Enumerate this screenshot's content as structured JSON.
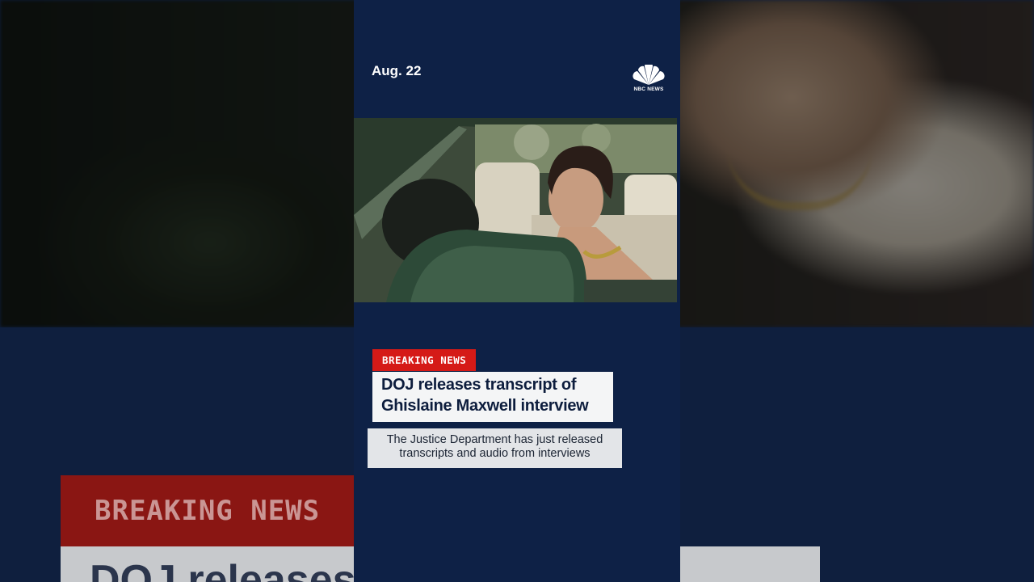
{
  "background": {
    "tag_text": "BREAKING NEWS",
    "headline_fragment": "DOJ releases transcript of"
  },
  "card": {
    "date": "Aug. 22",
    "logo": {
      "icon": "nbc-peacock-icon",
      "text": "NBC NEWS"
    },
    "photo": {
      "description_icon": "news-photo"
    },
    "tag": "BREAKING NEWS",
    "headline_line1": "DOJ releases transcript of",
    "headline_line2": "Ghislaine Maxwell interview",
    "subtext": "The Justice Department has just released transcripts and audio from interviews"
  },
  "colors": {
    "navy": "#0e2146",
    "breaking_red": "#d51a17",
    "headline_bg": "#f4f5f6",
    "subtext_bg": "#e3e5e8"
  }
}
